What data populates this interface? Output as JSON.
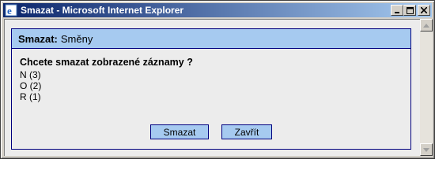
{
  "window": {
    "title": "Smazat - Microsoft Internet Explorer"
  },
  "panel": {
    "header_bold": "Smazat:",
    "header_text": "Směny"
  },
  "content": {
    "question": "Chcete smazat zobrazené záznamy ?",
    "items": [
      "N (3)",
      "O (2)",
      "R (1)"
    ]
  },
  "buttons": {
    "delete_label": "Smazat",
    "close_label": "Zavřít"
  },
  "colors": {
    "titlebar_start": "#0a246a",
    "titlebar_end": "#a6caf0",
    "panel_header_bg": "#a6caf0",
    "panel_border": "#00007f",
    "button_bg": "#a6caf0"
  }
}
